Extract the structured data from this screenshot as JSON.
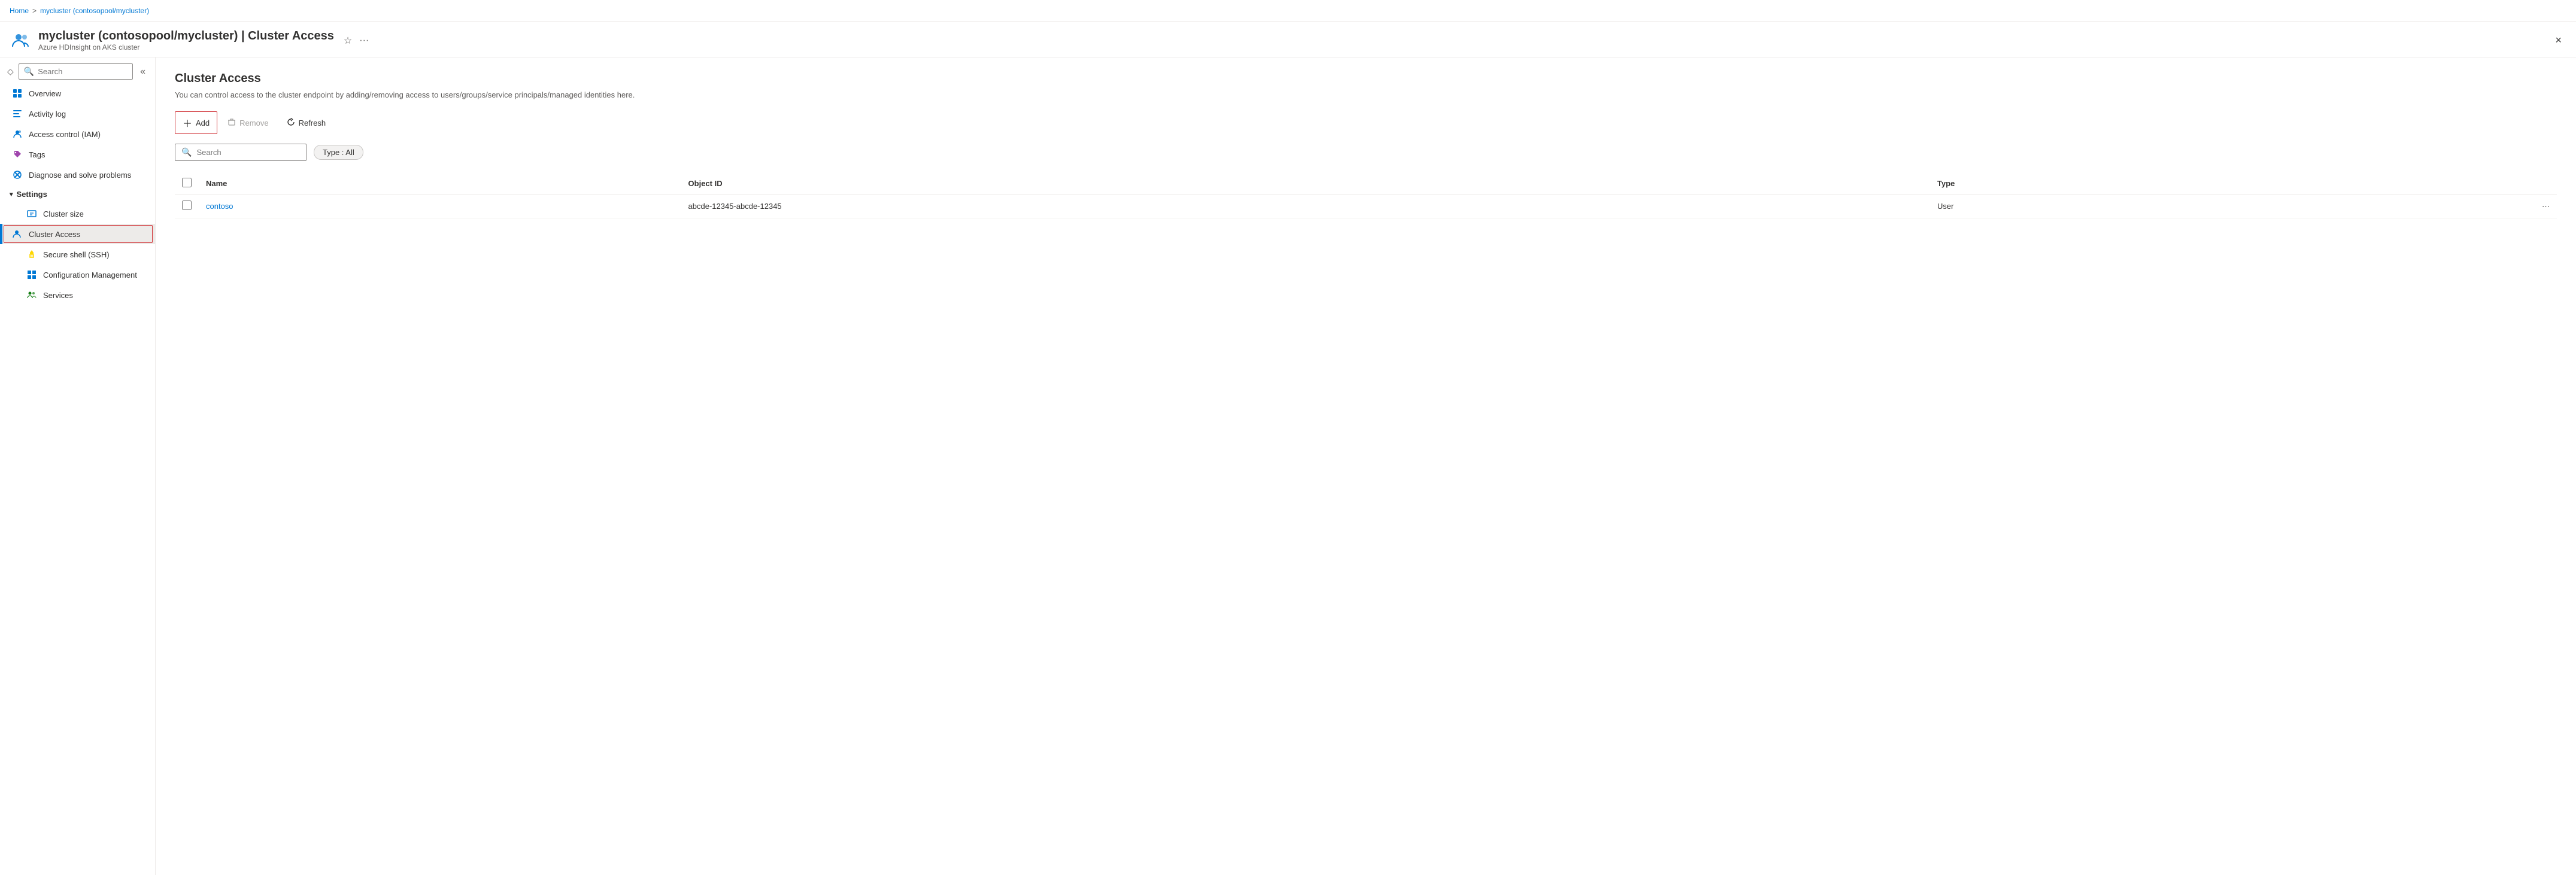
{
  "breadcrumb": {
    "home": "Home",
    "separator": ">",
    "current": "mycluster (contosopool/mycluster)"
  },
  "header": {
    "title": "mycluster (contosopool/mycluster) | Cluster Access",
    "subtitle": "Azure HDInsight on AKS cluster",
    "close_label": "×"
  },
  "sidebar": {
    "search_placeholder": "Search",
    "items": [
      {
        "id": "overview",
        "label": "Overview",
        "icon": "grid"
      },
      {
        "id": "activity-log",
        "label": "Activity log",
        "icon": "list"
      },
      {
        "id": "access-control",
        "label": "Access control (IAM)",
        "icon": "person-shield"
      },
      {
        "id": "tags",
        "label": "Tags",
        "icon": "tag"
      },
      {
        "id": "diagnose",
        "label": "Diagnose and solve problems",
        "icon": "wrench-x"
      }
    ],
    "section_settings": "Settings",
    "settings_items": [
      {
        "id": "cluster-size",
        "label": "Cluster size",
        "icon": "table-edit",
        "active": false
      },
      {
        "id": "cluster-access",
        "label": "Cluster Access",
        "icon": "person-key",
        "active": true
      },
      {
        "id": "secure-shell",
        "label": "Secure shell (SSH)",
        "icon": "key"
      },
      {
        "id": "config-management",
        "label": "Configuration Management",
        "icon": "squares"
      },
      {
        "id": "services",
        "label": "Services",
        "icon": "people-group"
      }
    ]
  },
  "content": {
    "title": "Cluster Access",
    "description": "You can control access to the cluster endpoint by adding/removing access to users/groups/service principals/managed identities here.",
    "toolbar": {
      "add_label": "Add",
      "remove_label": "Remove",
      "refresh_label": "Refresh"
    },
    "filter": {
      "search_placeholder": "Search",
      "type_badge": "Type : All"
    },
    "table": {
      "columns": [
        "Name",
        "Object ID",
        "Type"
      ],
      "rows": [
        {
          "name": "contoso",
          "object_id": "abcde-12345-abcde-12345",
          "type": "User"
        }
      ]
    }
  }
}
